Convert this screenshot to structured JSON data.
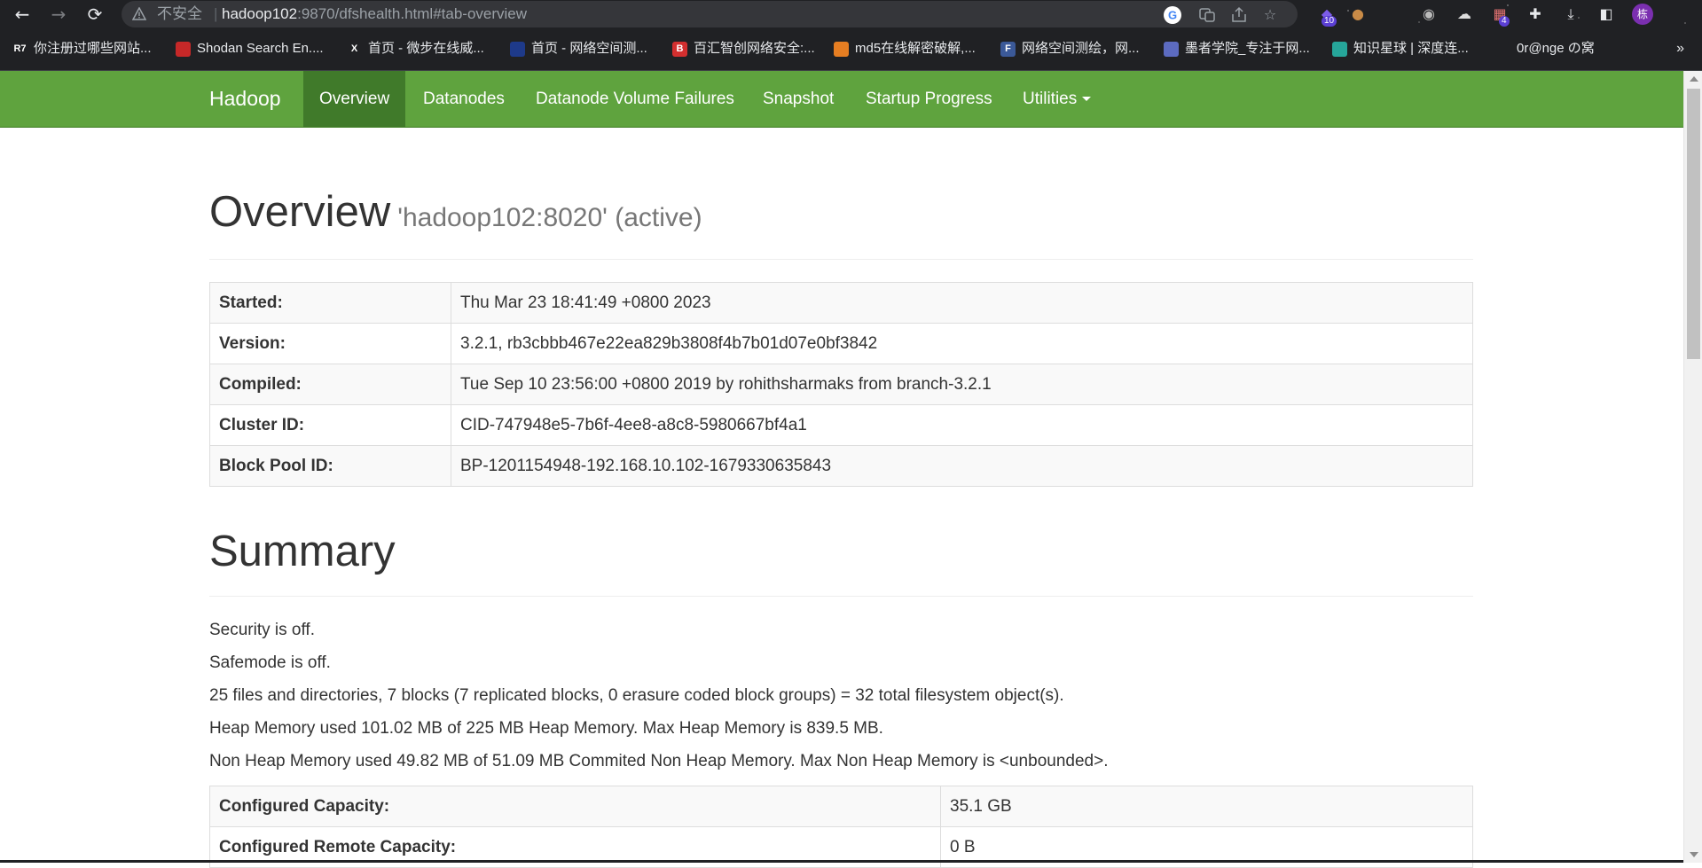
{
  "browser": {
    "insecure_label": "不安全",
    "url_host": "hadoop102",
    "url_rest": ":9870/dfshealth.html#tab-overview",
    "extension_badge_1": "10",
    "extension_badge_2": "4",
    "profile_initial": "栋",
    "bookmarks": [
      {
        "label": "你注册过哪些网站...",
        "favicon": "R7",
        "color": "#202124"
      },
      {
        "label": "Shodan Search En....",
        "favicon": "",
        "color": "#c62828"
      },
      {
        "label": "首页 - 微步在线威...",
        "favicon": "X",
        "color": "#202124"
      },
      {
        "label": "首页 - 网络空间测...",
        "favicon": "",
        "color": "#1e3a8a"
      },
      {
        "label": "百汇智创网络安全:...",
        "favicon": "B",
        "color": "#d32f2f"
      },
      {
        "label": "md5在线解密破解,...",
        "favicon": "",
        "color": "#e67e22"
      },
      {
        "label": "网络空间测绘，网...",
        "favicon": "F",
        "color": "#3b5998"
      },
      {
        "label": "墨者学院_专注于网...",
        "favicon": "",
        "color": "#5c6bc0"
      },
      {
        "label": "知识星球 | 深度连...",
        "favicon": "",
        "color": "#26a69a"
      },
      {
        "label": "0r@nge の窝",
        "favicon": "",
        "color": "#202124"
      }
    ],
    "more_bookmarks": "»"
  },
  "navbar": {
    "brand": "Hadoop",
    "items": [
      "Overview",
      "Datanodes",
      "Datanode Volume Failures",
      "Snapshot",
      "Startup Progress",
      "Utilities"
    ],
    "active": "Overview"
  },
  "overview": {
    "title": "Overview",
    "subtitle": "'hadoop102:8020' (active)",
    "rows": [
      {
        "label": "Started:",
        "value": "Thu Mar 23 18:41:49 +0800 2023"
      },
      {
        "label": "Version:",
        "value": "3.2.1, rb3cbbb467e22ea829b3808f4b7b01d07e0bf3842"
      },
      {
        "label": "Compiled:",
        "value": "Tue Sep 10 23:56:00 +0800 2019 by rohithsharmaks from branch-3.2.1"
      },
      {
        "label": "Cluster ID:",
        "value": "CID-747948e5-7b6f-4ee8-a8c8-5980667bf4a1"
      },
      {
        "label": "Block Pool ID:",
        "value": "BP-1201154948-192.168.10.102-1679330635843"
      }
    ]
  },
  "summary": {
    "title": "Summary",
    "lines": [
      "Security is off.",
      "Safemode is off.",
      "25 files and directories, 7 blocks (7 replicated blocks, 0 erasure coded block groups) = 32 total filesystem object(s).",
      "Heap Memory used 101.02 MB of 225 MB Heap Memory. Max Heap Memory is 839.5 MB.",
      "Non Heap Memory used 49.82 MB of 51.09 MB Commited Non Heap Memory. Max Non Heap Memory is <unbounded>."
    ],
    "rows": [
      {
        "label": "Configured Capacity:",
        "value": "35.1 GB"
      },
      {
        "label": "Configured Remote Capacity:",
        "value": "0 B"
      }
    ]
  }
}
